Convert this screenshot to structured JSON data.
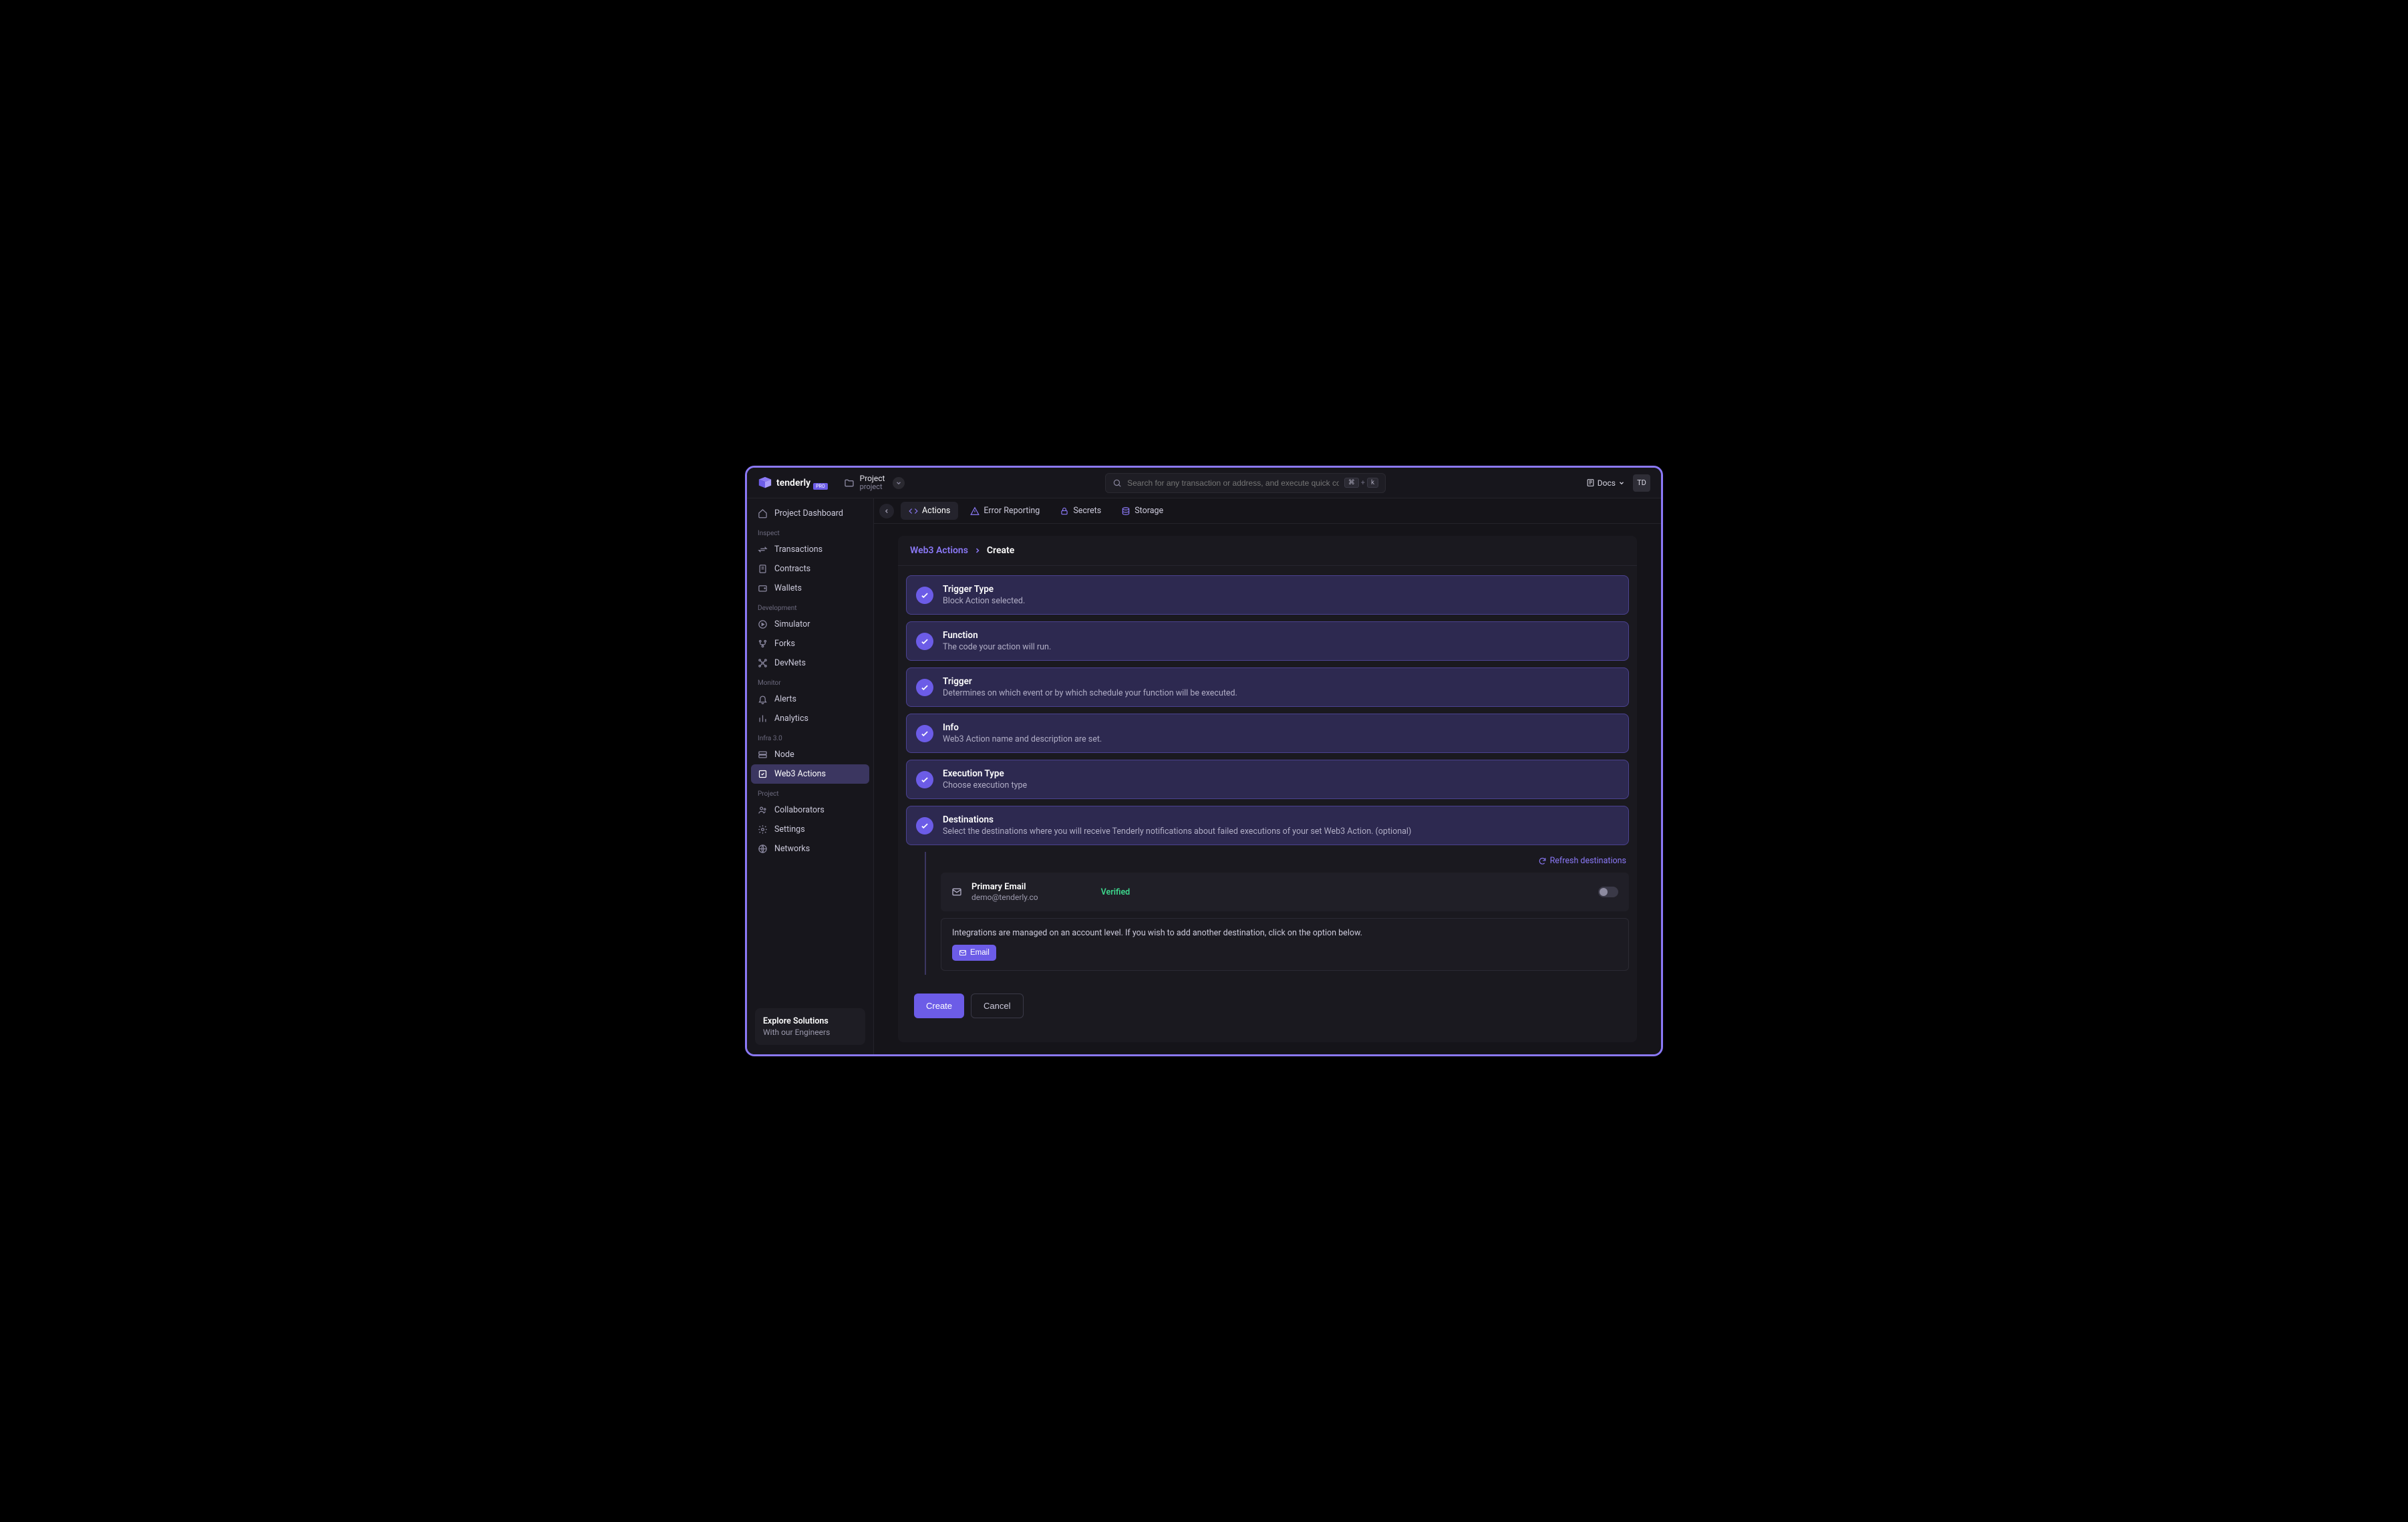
{
  "brand": {
    "name": "tenderly",
    "badge": "PRO"
  },
  "project": {
    "title": "Project",
    "subtitle": "project"
  },
  "search": {
    "placeholder": "Search for any transaction or address, and execute quick comma...",
    "kbd_mod": "⌘",
    "kbd_plus": "+",
    "kbd_key": "k"
  },
  "header": {
    "docs": "Docs",
    "avatar": "TD"
  },
  "sidebar": {
    "dashboard": "Project Dashboard",
    "sections": {
      "inspect": {
        "heading": "Inspect",
        "transactions": "Transactions",
        "contracts": "Contracts",
        "wallets": "Wallets"
      },
      "development": {
        "heading": "Development",
        "simulator": "Simulator",
        "forks": "Forks",
        "devnets": "DevNets"
      },
      "monitor": {
        "heading": "Monitor",
        "alerts": "Alerts",
        "analytics": "Analytics"
      },
      "infra": {
        "heading": "Infra 3.0",
        "node": "Node",
        "web3actions": "Web3 Actions"
      },
      "project": {
        "heading": "Project",
        "collaborators": "Collaborators",
        "settings": "Settings",
        "networks": "Networks"
      }
    },
    "explore": {
      "title": "Explore Solutions",
      "subtitle": "With our Engineers"
    }
  },
  "tabs": {
    "actions": "Actions",
    "error_reporting": "Error Reporting",
    "secrets": "Secrets",
    "storage": "Storage"
  },
  "breadcrumb": {
    "root": "Web3 Actions",
    "current": "Create"
  },
  "steps": [
    {
      "title": "Trigger Type",
      "desc": "Block Action selected."
    },
    {
      "title": "Function",
      "desc": "The code your action will run."
    },
    {
      "title": "Trigger",
      "desc": "Determines on which event or by which schedule your function will be executed."
    },
    {
      "title": "Info",
      "desc": "Web3 Action name and description are set."
    },
    {
      "title": "Execution Type",
      "desc": "Choose execution type"
    },
    {
      "title": "Destinations",
      "desc": "Select the destinations where you will receive Tenderly notifications about failed executions of your set Web3 Action. (optional)"
    }
  ],
  "destinations": {
    "refresh": "Refresh destinations",
    "primary": {
      "label": "Primary Email",
      "email": "demo@tenderly.co",
      "status": "Verified"
    },
    "info": "Integrations are managed on an account level. If you wish to add another destination, click on the option below.",
    "email_btn": "Email"
  },
  "actions": {
    "create": "Create",
    "cancel": "Cancel"
  }
}
